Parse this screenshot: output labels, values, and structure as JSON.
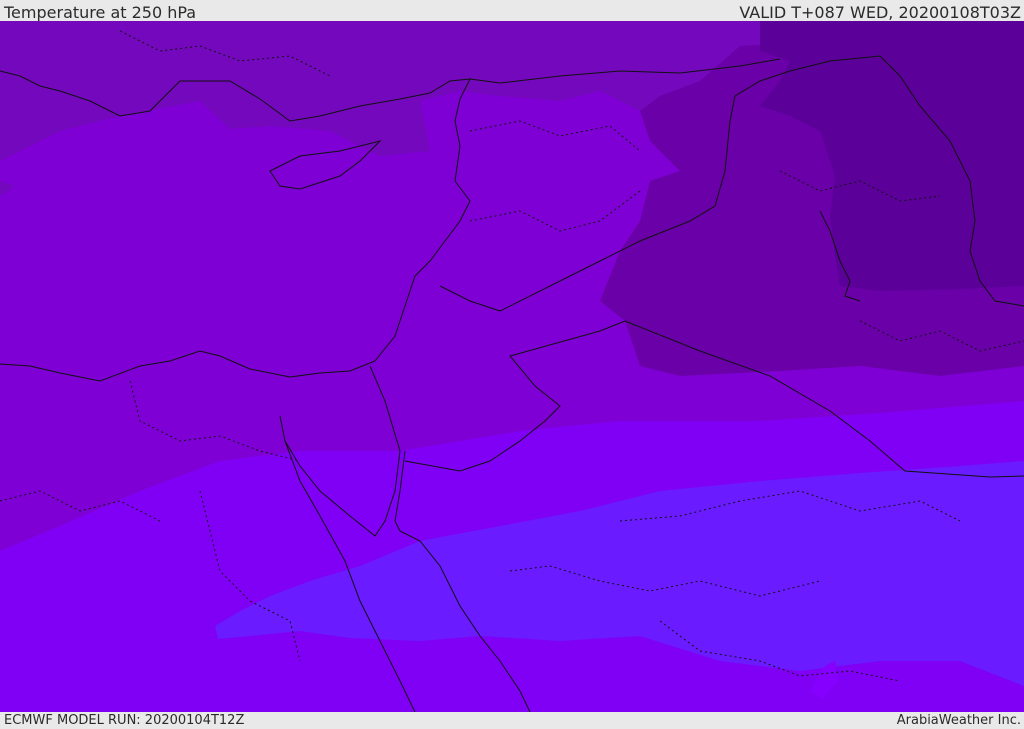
{
  "header": {
    "title": "Temperature at 250 hPa",
    "valid": "VALID T+087 WED, 20200108T03Z"
  },
  "footer": {
    "model_run": "ECMWF MODEL RUN: 20200104T12Z",
    "brand": "ArabiaWeather Inc."
  },
  "map": {
    "colors": {
      "band_darkest": "#5c009a",
      "band_dark": "#6a00a8",
      "band_mid_dark": "#7408bc",
      "band_main": "#7f00d5",
      "band_light": "#8000f6",
      "band_blue": "#6a1bff",
      "band_bright": "#8500ff",
      "line": "#111111"
    }
  }
}
